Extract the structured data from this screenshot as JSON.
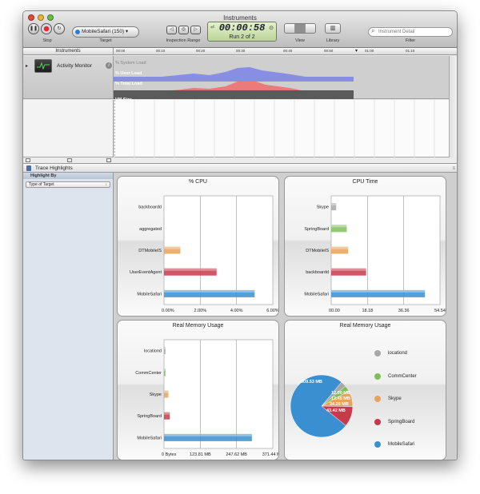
{
  "window": {
    "title": "Instruments"
  },
  "toolbar": {
    "stop_label": "Stop",
    "target_value": "MobileSafari (150) ▾",
    "target_label": "Target",
    "inspection_label": "Inspection Range",
    "time": "00:00:58",
    "run": "Run 2 of 2",
    "view_label": "View",
    "library_label": "Library",
    "filter_placeholder": "Instrument Detail",
    "filter_label": "Filter"
  },
  "ruler": {
    "header": "Instruments",
    "ticks": [
      "00:00",
      "00:10",
      "00:20",
      "00:30",
      "00:40",
      "00:50",
      "01:00",
      "01:10"
    ]
  },
  "track": {
    "instrument": "Activity Monitor",
    "lanes": [
      "% System Load",
      "% User Load",
      "% Total Load",
      "VM Size"
    ]
  },
  "trace_highlights": {
    "title": "Trace Highlights",
    "highlight_by": "Highlight By",
    "type_select": "Type of Target"
  },
  "colors": {
    "blue": "#3a8fd0",
    "red": "#c83a4a",
    "orange": "#e8a25a",
    "green": "#7fbf5a",
    "gray": "#a8a8a8"
  },
  "chart_data": [
    {
      "type": "bar",
      "title": "% CPU",
      "orientation": "horizontal",
      "categories": [
        "backboardd",
        "aggregated",
        "DTMobileIS",
        "UserEventAgent",
        "MobileSafari"
      ],
      "values": [
        0.0,
        0.0,
        0.9,
        2.9,
        5.0
      ],
      "colors": [
        "gray",
        "gray",
        "orange",
        "red",
        "blue"
      ],
      "xlim": [
        0,
        6
      ],
      "ticks": [
        "0.00%",
        "2.00%",
        "4.00%",
        "6.00%"
      ]
    },
    {
      "type": "bar",
      "title": "CPU Time",
      "orientation": "horizontal",
      "categories": [
        "Skype",
        "SpringBoard",
        "DTMobileIS",
        "backboardd",
        "MobileSafari"
      ],
      "values": [
        2.5,
        7.8,
        8.5,
        17.5,
        47
      ],
      "colors": [
        "gray",
        "green",
        "orange",
        "red",
        "blue"
      ],
      "xlim": [
        0,
        54.54
      ],
      "ticks": [
        "00.00",
        "18.18",
        "36.36",
        "54.54"
      ]
    },
    {
      "type": "bar",
      "title": "Real Memory Usage",
      "orientation": "horizontal",
      "categories": [
        "locationd",
        "CommCenter",
        "Skype",
        "SpringBoard",
        "MobileSafari"
      ],
      "values": [
        5,
        5,
        15,
        20,
        300
      ],
      "colors": [
        "gray",
        "green",
        "orange",
        "red",
        "blue"
      ],
      "xlim": [
        0,
        371.44
      ],
      "ticks": [
        "0 Bytes",
        "123.81 MB",
        "247.62 MB",
        "371.44 MB"
      ]
    },
    {
      "type": "pie",
      "title": "Real Memory Usage",
      "labels": [
        "locationd",
        "CommCenter",
        "Skype",
        "SpringBoard",
        "MobileSafari"
      ],
      "values": [
        12.0,
        12.45,
        34.26,
        43.42,
        309.53
      ],
      "slice_labels": [
        "12.00 MB",
        "12.45 MB",
        "34.26 MB",
        "43.42 MB",
        "309.53 MB"
      ],
      "colors": [
        "gray",
        "green",
        "orange",
        "red",
        "blue"
      ]
    }
  ]
}
